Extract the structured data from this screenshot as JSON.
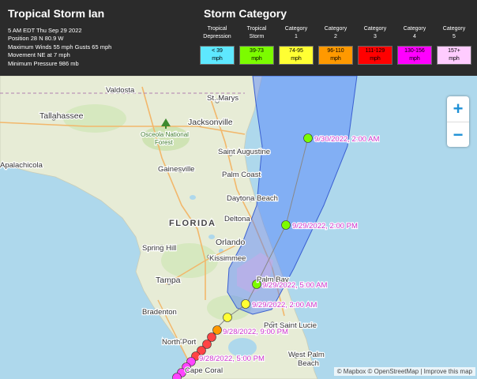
{
  "storm": {
    "title": "Tropical Storm Ian",
    "info": [
      "5 AM EDT Thu Sep 29 2022",
      "Position 28 N 80.9 W",
      "Maximum Winds 55 mph Gusts 65 mph",
      "Movement NE at 7 mph",
      "Minimum Pressure 986 mb"
    ]
  },
  "categories": {
    "title": "Storm Category",
    "items": [
      {
        "name1": "Tropical",
        "name2": "Depression",
        "range": "< 39",
        "unit": "mph",
        "color": "#5ee8ff"
      },
      {
        "name1": "Tropical",
        "name2": "Storm",
        "range": "39-73",
        "unit": "mph",
        "color": "#7cfc00"
      },
      {
        "name1": "Category",
        "name2": "1",
        "range": "74-95",
        "unit": "mph",
        "color": "#ffff33"
      },
      {
        "name1": "Category",
        "name2": "2",
        "range": "96-110",
        "unit": "mph",
        "color": "#ff9900"
      },
      {
        "name1": "Category",
        "name2": "3",
        "range": "111-129",
        "unit": "mph",
        "color": "#ff0000"
      },
      {
        "name1": "Category",
        "name2": "4",
        "range": "130-156",
        "unit": "mph",
        "color": "#ff00ff"
      },
      {
        "name1": "Category",
        "name2": "5",
        "range": "157+",
        "unit": "mph",
        "color": "#ffccff"
      }
    ]
  },
  "map": {
    "state_label": "FLORIDA",
    "forest_label_1": "Osceola National",
    "forest_label_2": "Forest",
    "cities": {
      "valdosta": "Valdosta",
      "tallahassee": "Tallahassee",
      "apalachicola": "Apalachicola",
      "st_marys": "St. Marys",
      "jacksonville": "Jacksonville",
      "gainesville": "Gainesville",
      "saint_augustine": "Saint Augustine",
      "palm_coast": "Palm Coast",
      "daytona": "Daytona Beach",
      "deltona": "Deltona",
      "orlando": "Orlando",
      "spring_hill": "Spring Hill",
      "kissimmee": "Kissimmee",
      "tampa": "Tampa",
      "palm_bay": "Palm Bay",
      "bradenton": "Bradenton",
      "port_saint_lucie": "Port Saint Lucie",
      "north_port": "North Port",
      "west_palm": "West Palm",
      "beach": "Beach",
      "cape_coral": "Cape Coral"
    },
    "track_labels": {
      "t1": "9/30/2022, 2:00 AM",
      "t2": "9/29/2022, 2:00 PM",
      "t3": "9/29/2022, 5:00 AM",
      "t4": "9/29/2022, 2:00 AM",
      "t5": "9/28/2022, 9:00 PM",
      "t6": "9/28/2022, 5:00 PM"
    },
    "colors": {
      "forecast_cone": "#4d7fff",
      "track_label": "#cc33cc"
    }
  },
  "zoom": {
    "plus": "+",
    "minus": "−"
  },
  "attribution": {
    "mapbox": "© Mapbox",
    "osm": "© OpenStreetMap",
    "separator": "|",
    "improve": "Improve this map"
  }
}
